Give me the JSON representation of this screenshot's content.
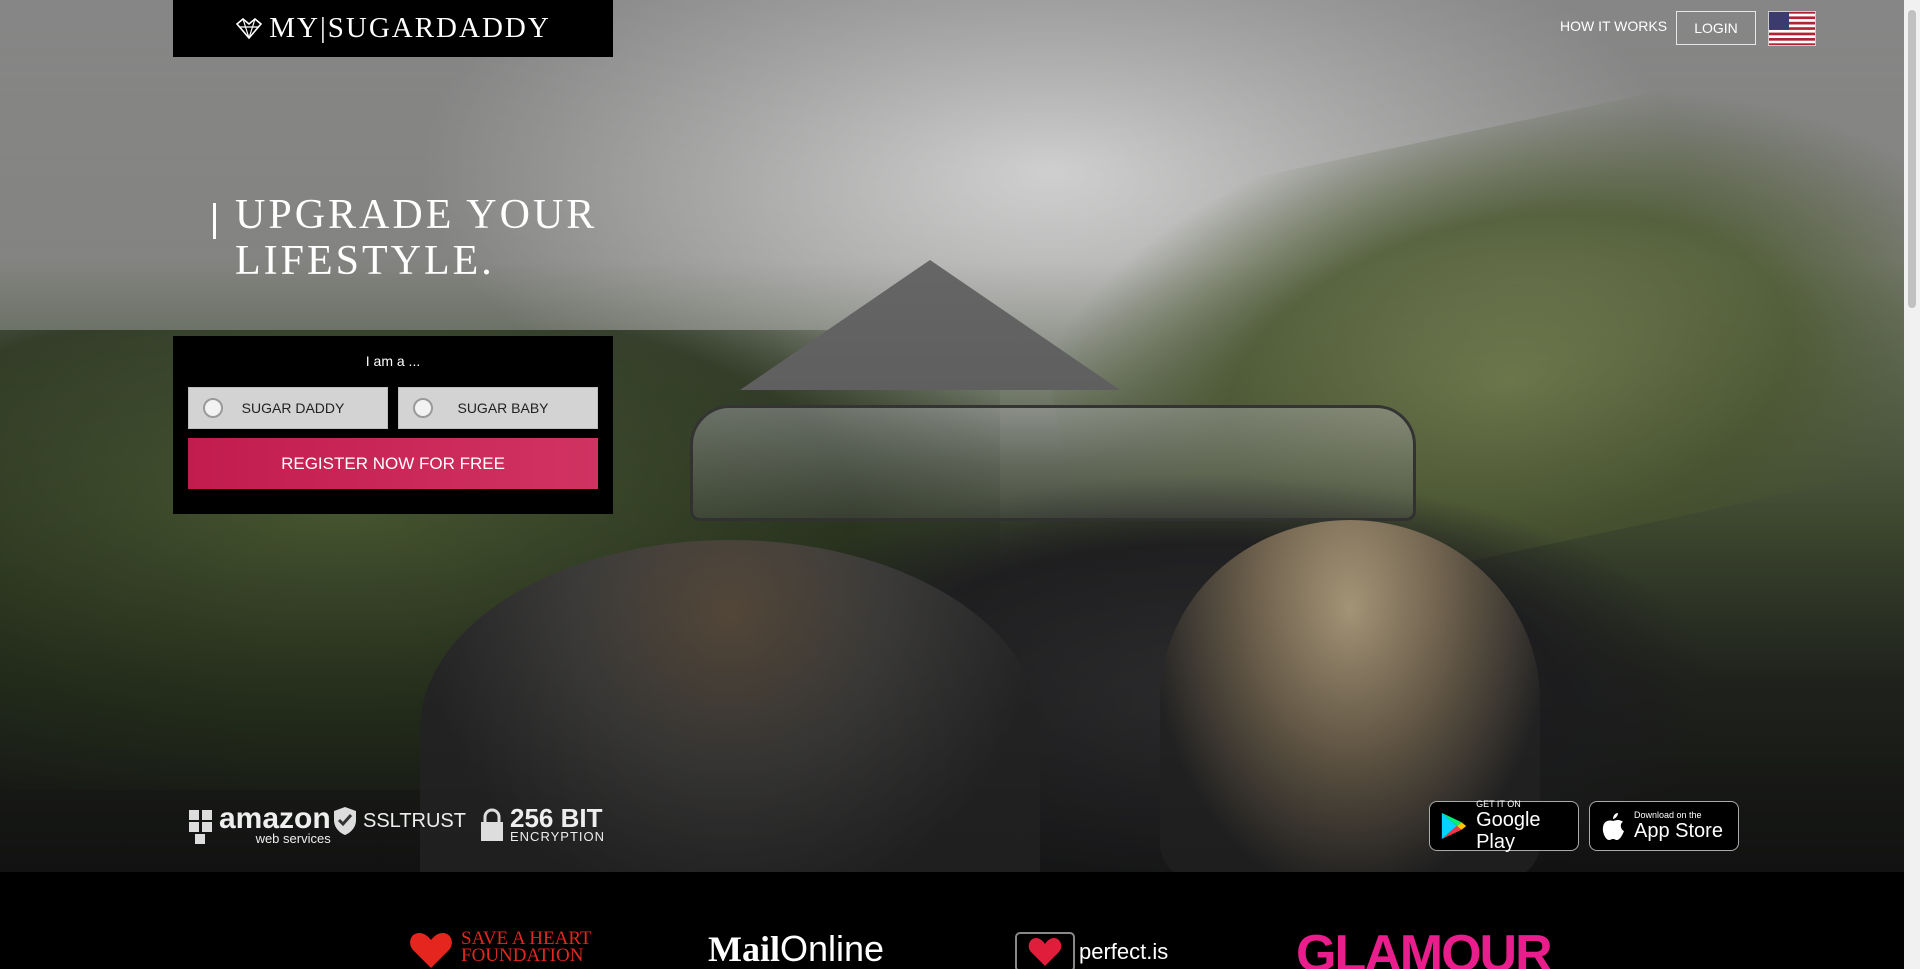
{
  "header": {
    "logo_text": "MY|SUGARDADDY",
    "nav_how_it_works": "HOW IT WORKS",
    "nav_login": "LOGIN"
  },
  "hero": {
    "headline_line1": "UPGRADE YOUR",
    "headline_line2": "LIFESTYLE."
  },
  "signup": {
    "prompt": "I am a ...",
    "role_sugar_daddy": "SUGAR DADDY",
    "role_sugar_baby": "SUGAR BABY",
    "register_button": "REGISTER NOW FOR FREE"
  },
  "trust_badges": {
    "aws_main": "amazon",
    "aws_sub": "web services",
    "ssl": "SSLTRUST",
    "encryption_big": "256 BIT",
    "encryption_small": "ENCRYPTION"
  },
  "app_stores": {
    "google_small": "GET IT ON",
    "google_big": "Google Play",
    "apple_small": "Download on the",
    "apple_big": "App Store"
  },
  "press": {
    "save_a_heart_line1": "SAVE A HEART",
    "save_a_heart_line2": "FOUNDATION",
    "mail": "Mail",
    "online": "Online",
    "perfect": "perfect.is",
    "glamour": "GLAMOUR"
  },
  "colors": {
    "register_accent": "#c21c4f",
    "glamour_pink": "#e91e8c",
    "save_a_heart_red": "#e4261f"
  }
}
